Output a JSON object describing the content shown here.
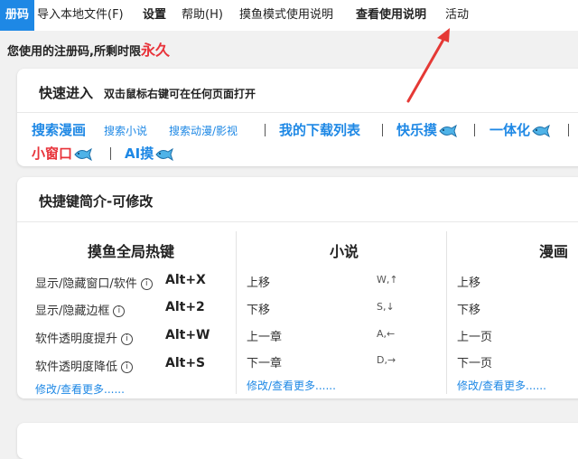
{
  "menu": {
    "active": "册码",
    "import": "导入本地文件(F)",
    "settings": "设置",
    "help": "帮助(H)",
    "fish_mode": "摸鱼模式使用说明",
    "view_guide": "查看使用说明",
    "activity": "活动"
  },
  "notice": {
    "text": "您使用的注册码,所剩时限",
    "value": "永久"
  },
  "quick": {
    "title": "快速进入",
    "subtitle": "双击鼠标右键可在任何页面打开",
    "links": {
      "search_comic": "搜索漫画",
      "search_novel": "搜索小说",
      "search_anime": "搜索动漫/影视",
      "downloads": "我的下载列表",
      "happy_fish": "快乐摸",
      "all_in_one": "一体化",
      "mini_window": "小窗口",
      "ai_fish": "AI摸"
    }
  },
  "shortcuts": {
    "title": "快捷键简介-可修改",
    "global": {
      "title": "摸鱼全局热键",
      "rows": [
        {
          "label": "显示/隐藏窗口/软件",
          "key": "Alt+X"
        },
        {
          "label": "显示/隐藏边框",
          "key": "Alt+2"
        },
        {
          "label": "软件透明度提升",
          "key": "Alt+W"
        },
        {
          "label": "软件透明度降低",
          "key": "Alt+S"
        }
      ],
      "more": "修改/查看更多......"
    },
    "novel": {
      "title": "小说",
      "rows": [
        {
          "label": "上移",
          "key": "W,↑"
        },
        {
          "label": "下移",
          "key": "S,↓"
        },
        {
          "label": "上一章",
          "key": "A,←"
        },
        {
          "label": "下一章",
          "key": "D,→"
        }
      ],
      "more": "修改/查看更多......"
    },
    "comic": {
      "title": "漫画",
      "rows": [
        {
          "label": "上移"
        },
        {
          "label": "下移"
        },
        {
          "label": "上一页"
        },
        {
          "label": "下一页"
        }
      ],
      "more": "修改/查看更多......"
    }
  },
  "colors": {
    "accent": "#1e88e5",
    "red": "#e8333a",
    "bg": "#f1f1f1",
    "arrow": "#e53935"
  },
  "icons": {
    "fish": "fish-icon",
    "info": "info-icon"
  }
}
